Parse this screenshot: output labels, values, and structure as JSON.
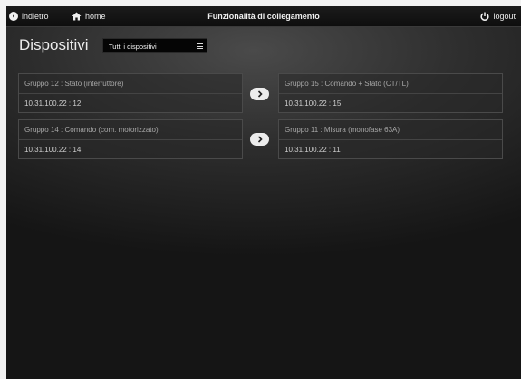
{
  "topbar": {
    "back_label": "indietro",
    "home_label": "home",
    "title": "Funzionalità di collegamento",
    "logout_label": "logout"
  },
  "page": {
    "heading": "Dispositivi",
    "filter_selected": "Tutti i dispositivi"
  },
  "links": [
    {
      "source": {
        "name": "Gruppo 12 : Stato (interruttore)",
        "address": "10.31.100.22 : 12"
      },
      "target": {
        "name": "Gruppo 15 : Comando + Stato (CT/TL)",
        "address": "10.31.100.22 : 15"
      }
    },
    {
      "source": {
        "name": "Gruppo 14 : Comando (com. motorizzato)",
        "address": "10.31.100.22 : 14"
      },
      "target": {
        "name": "Gruppo 11 : Misura (monofase 63A)",
        "address": "10.31.100.22 : 11"
      }
    }
  ],
  "icons": {
    "back": "back-arrow-icon",
    "home": "home-icon",
    "logout": "power-icon",
    "link": "chevron-right-icon",
    "menu": "menu-icon"
  }
}
